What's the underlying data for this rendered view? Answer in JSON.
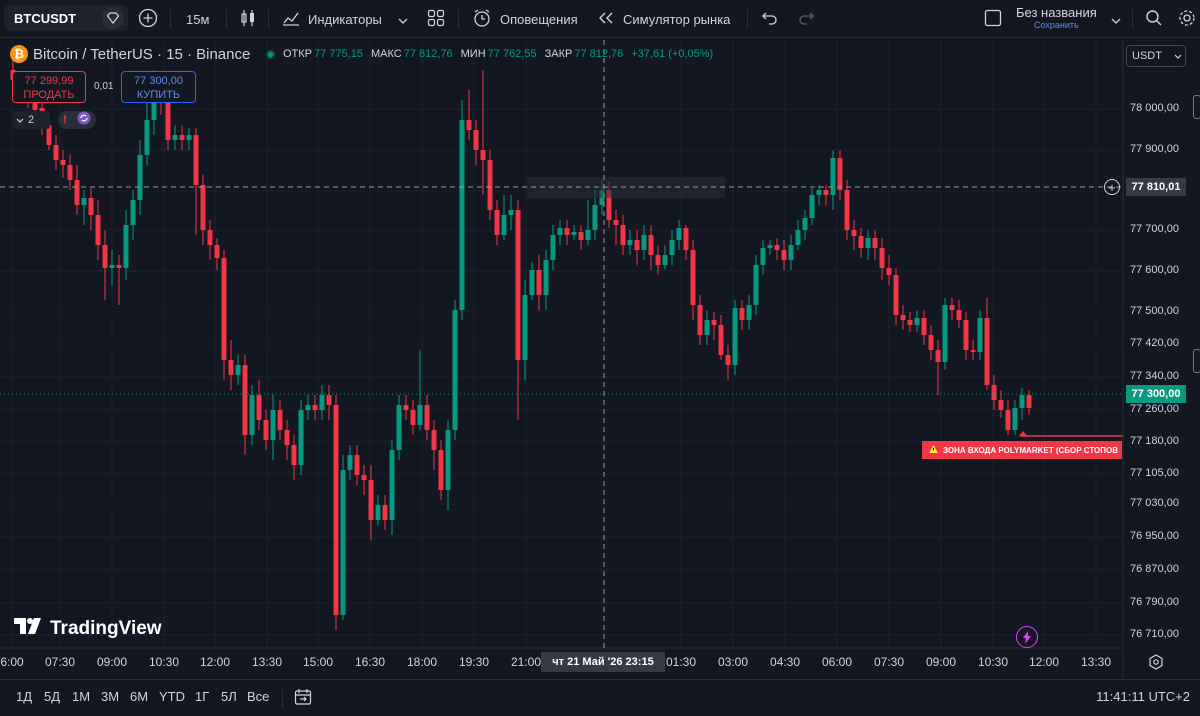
{
  "toolbar": {
    "symbol": "BTCUSDT",
    "interval": "15м",
    "indicators_label": "Индикаторы",
    "alerts_label": "Оповещения",
    "replay_label": "Симулятор рынка",
    "layout_name": "Без названия",
    "layout_status": "Сохранить"
  },
  "legend": {
    "logo_glyph": "₿",
    "title": "Bitcoin / TetherUS · 15 · Binance",
    "open_label": "ОТКР",
    "open": "77 775,15",
    "high_label": "МАКС",
    "high": "77 812,76",
    "low_label": "МИН",
    "low": "77 762,55",
    "close_label": "ЗАКР",
    "close": "77 812,76",
    "change": "+37,61 (+0,05%)"
  },
  "trade": {
    "sell_price": "77 299,99",
    "sell_label": "ПРОДАТЬ",
    "quantity": "0,01",
    "buy_price": "77 300,00",
    "buy_label": "КУПИТЬ"
  },
  "indicators_count": "2",
  "currency": "USDT",
  "price_axis": [
    "78 000,00",
    "77 900,00",
    "77 700,00",
    "77 600,00",
    "77 500,00",
    "77 420,00",
    "77 340,00",
    "77 260,00",
    "77 180,00",
    "77 105,00",
    "77 030,00",
    "76 950,00",
    "76 870,00",
    "76 790,00",
    "76 710,00"
  ],
  "crosshair_price": "77 810,01",
  "current_price": "77 300,00",
  "zone_label": "ЗОНА ВХОДА POLYMARKET (СБОР СТОПОВ",
  "time_axis": [
    "6:00",
    "07:30",
    "09:00",
    "10:30",
    "12:00",
    "13:30",
    "15:00",
    "16:30",
    "18:00",
    "19:30",
    "21:00",
    "01:30",
    "03:00",
    "04:30",
    "06:00",
    "07:30",
    "09:00",
    "10:30",
    "12:00",
    "13:30"
  ],
  "crosshair_time": "чт 21 Май '26   23:15",
  "brand": "TradingView",
  "ranges": [
    "1Д",
    "5Д",
    "1М",
    "3М",
    "6М",
    "YTD",
    "1Г",
    "5Л",
    "Все"
  ],
  "clock": "11:41:11 UTC+2",
  "colors": {
    "up": "#089981",
    "down": "#f23645",
    "background": "#131722",
    "accent": "#2962ff"
  }
}
